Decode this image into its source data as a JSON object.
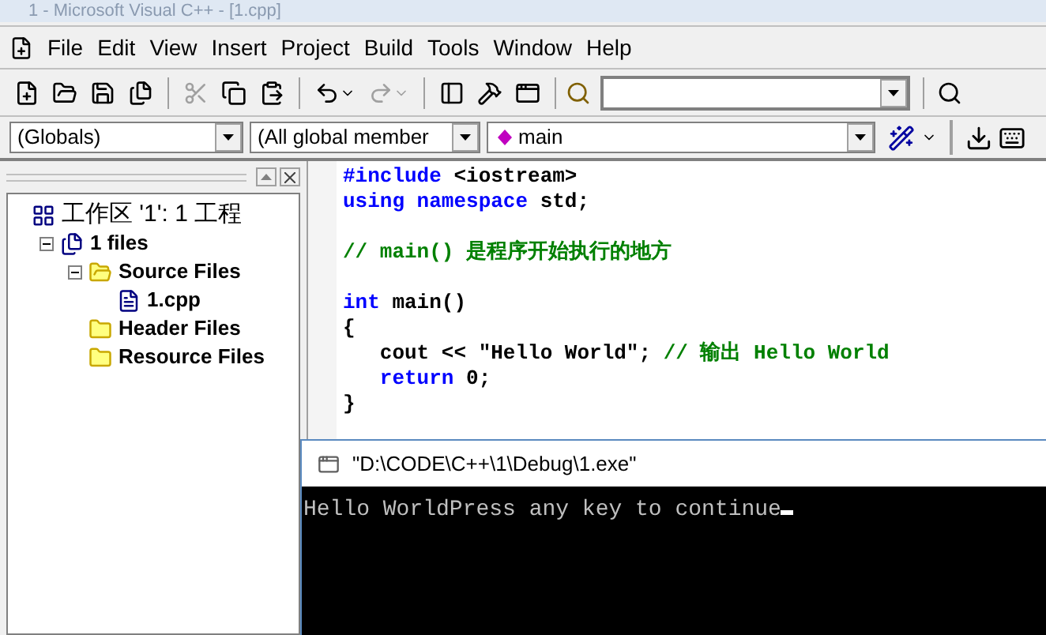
{
  "window": {
    "title": "1 - Microsoft Visual C++ - [1.cpp]"
  },
  "menu": [
    "File",
    "Edit",
    "View",
    "Insert",
    "Project",
    "Build",
    "Tools",
    "Window",
    "Help"
  ],
  "toolbar": {
    "buttons": [
      {
        "kind": "new",
        "disabled": false
      },
      {
        "kind": "open",
        "disabled": false
      },
      {
        "kind": "save",
        "disabled": false
      },
      {
        "kind": "saveall",
        "disabled": false
      },
      {
        "kind": "sep"
      },
      {
        "kind": "cut",
        "disabled": true
      },
      {
        "kind": "copy",
        "disabled": false
      },
      {
        "kind": "paste",
        "disabled": false
      },
      {
        "kind": "sep"
      },
      {
        "kind": "undo",
        "disabled": false
      },
      {
        "kind": "redo",
        "disabled": true
      },
      {
        "kind": "sep"
      },
      {
        "kind": "workspace",
        "disabled": false
      },
      {
        "kind": "output",
        "disabled": false
      },
      {
        "kind": "windows",
        "disabled": false
      }
    ]
  },
  "wizard_bar": {
    "class_combo": "(Globals)",
    "members_combo": "(All global member",
    "function_combo": "main"
  },
  "workspace": {
    "tree": [
      {
        "label": "工作区 '1': 1 工程",
        "kind": "workspace",
        "children": [
          {
            "label": "1 files",
            "kind": "project",
            "expanded": true,
            "children": [
              {
                "label": "Source Files",
                "kind": "folder",
                "expanded": true,
                "children": [
                  {
                    "label": "1.cpp",
                    "kind": "file"
                  }
                ]
              },
              {
                "label": "Header Files",
                "kind": "folder",
                "expanded": false
              },
              {
                "label": "Resource Files",
                "kind": "folder",
                "expanded": false
              }
            ]
          }
        ]
      }
    ]
  },
  "editor": {
    "lines": [
      {
        "kind": "code",
        "tokens": [
          {
            "text": "#include",
            "kind": "keyword"
          },
          {
            "text": " <iostream>",
            "kind": "plain"
          }
        ]
      },
      {
        "kind": "code",
        "tokens": [
          {
            "text": "using namespace",
            "kind": "keyword"
          },
          {
            "text": " std;",
            "kind": "plain"
          }
        ]
      },
      {
        "kind": "blank"
      },
      {
        "kind": "code",
        "tokens": [
          {
            "text": "// main() 是程序开始执行的地方",
            "kind": "comment"
          }
        ]
      },
      {
        "kind": "blank"
      },
      {
        "kind": "code",
        "tokens": [
          {
            "text": "int",
            "kind": "keyword"
          },
          {
            "text": " main()",
            "kind": "plain"
          }
        ]
      },
      {
        "kind": "code",
        "tokens": [
          {
            "text": "{",
            "kind": "plain"
          }
        ]
      },
      {
        "kind": "code",
        "tokens": [
          {
            "text": "   cout << \"Hello World\"; ",
            "kind": "plain"
          },
          {
            "text": "// 输出 Hello World",
            "kind": "comment"
          }
        ]
      },
      {
        "kind": "code",
        "tokens": [
          {
            "text": "   return",
            "kind": "keyword"
          },
          {
            "text": " 0;",
            "kind": "plain"
          }
        ]
      },
      {
        "kind": "code",
        "tokens": [
          {
            "text": "}",
            "kind": "plain"
          }
        ]
      }
    ]
  },
  "console": {
    "title": "\"D:\\CODE\\C++\\1\\Debug\\1.exe\"",
    "output": "Hello WorldPress any key to continue"
  }
}
